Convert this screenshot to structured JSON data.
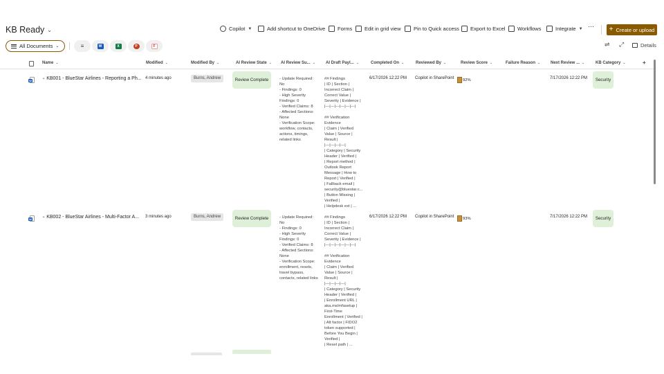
{
  "library": {
    "title": "KB Ready"
  },
  "commands": {
    "copilot": "Copilot",
    "add_shortcut": "Add shortcut to OneDrive",
    "forms": "Forms",
    "edit_grid": "Edit in grid view",
    "pin": "Pin to Quick access",
    "export": "Export to Excel",
    "workflows": "Workflows",
    "integrate": "Integrate",
    "more": "···",
    "create": "Create or upload"
  },
  "viewbar": {
    "view_name": "All Documents",
    "details": "Details",
    "filter_apps": [
      "W",
      "X",
      "P",
      "F"
    ]
  },
  "columns": [
    "Name",
    "Modified",
    "Modified By",
    "AI Review State",
    "AI Review Su...",
    "AI Draft Payl...",
    "Completed On",
    "Reviewed By",
    "Review Score",
    "Failure Reason",
    "Next Review ...",
    "KB Category"
  ],
  "rows": [
    {
      "name": "KB001 - BlueStar Airlines - Reporting a Ph...",
      "modified": "4 minutes ago",
      "modified_by": "Burns, Andrew",
      "review_state": "Review Complete",
      "review_summary": "- Update Required:\nNo\n- Findings: 0\n- High Severity\nFindings: 0\n- Verified Claims: 8\n- Affected Sections:\nNone\n- Verification Scope:\nworkflow, contacts,\nactions, timings,\nrelated links",
      "draft_payload": "## Findings\n| ID | Section |\nIncorrect Claim |\nCorrect Value |\nSeverity | Evidence |\n|---|---|---|---|---|---|\n\n## Verification\nEvidence\n| Claim | Verified\nValue | Source |\nResult |\n|---|---|---|---|\n| Category | Security\nHeader | Verified |\n| Report method |\nOutlook Report\nMessage | How to\nReport | Verified |\n| Fallback email |\nsecurity@bluestar.c...\n| Button Missing |\nVerified |\n| Helpdesk ext | ...",
      "completed_on": "6/17/2026 12:22 PM",
      "reviewed_by": "Copilot in SharePoint",
      "review_score": "92%",
      "review_score_value": 0.92,
      "failure_reason": "",
      "next_review": "7/17/2026 12:22 PM",
      "kb_category": "Security"
    },
    {
      "name": "KB002 - BlueStar Airlines - Multi-Factor A...",
      "modified": "3 minutes ago",
      "modified_by": "Burns, Andrew",
      "review_state": "Review Complete",
      "review_summary": "- Update Required:\nNo\n- Findings: 0\n- High Severity\nFindings: 0\n- Verified Claims: 8\n- Affected Sections:\nNone\n- Verification Scope:\nenrollment, resets,\ntravel bypass,\ncontacts, related links",
      "draft_payload": "## Findings\n| ID | Section |\nIncorrect Claim |\nCorrect Value |\nSeverity | Evidence |\n|---|---|---|---|---|---|\n\n## Verification\nEvidence\n| Claim | Verified\nValue | Source |\nResult |\n|---|---|---|---|\n| Category | Security\nHeader | Verified |\n| Enrollment URL |\naka.ms/mfasetup |\nFirst-Time\nEnrollment | Verified |\n| Alt factor | FIDO2\ntoken supported |\nBefore You Begin |\nVerified |\n| Reset path | ...",
      "completed_on": "6/17/2026 12:22 PM",
      "reviewed_by": "Copilot in SharePoint",
      "review_score": "93%",
      "review_score_value": 0.93,
      "failure_reason": "",
      "next_review": "7/17/2026 12:22 PM",
      "kb_category": "Security"
    }
  ],
  "colors": {
    "accent": "#8a5a00",
    "status_green": "#dff0d8",
    "word_blue": "#185abd",
    "excel_green": "#107c41",
    "ppt_red": "#c43e1c",
    "forms_red": "#e8a0a0"
  }
}
